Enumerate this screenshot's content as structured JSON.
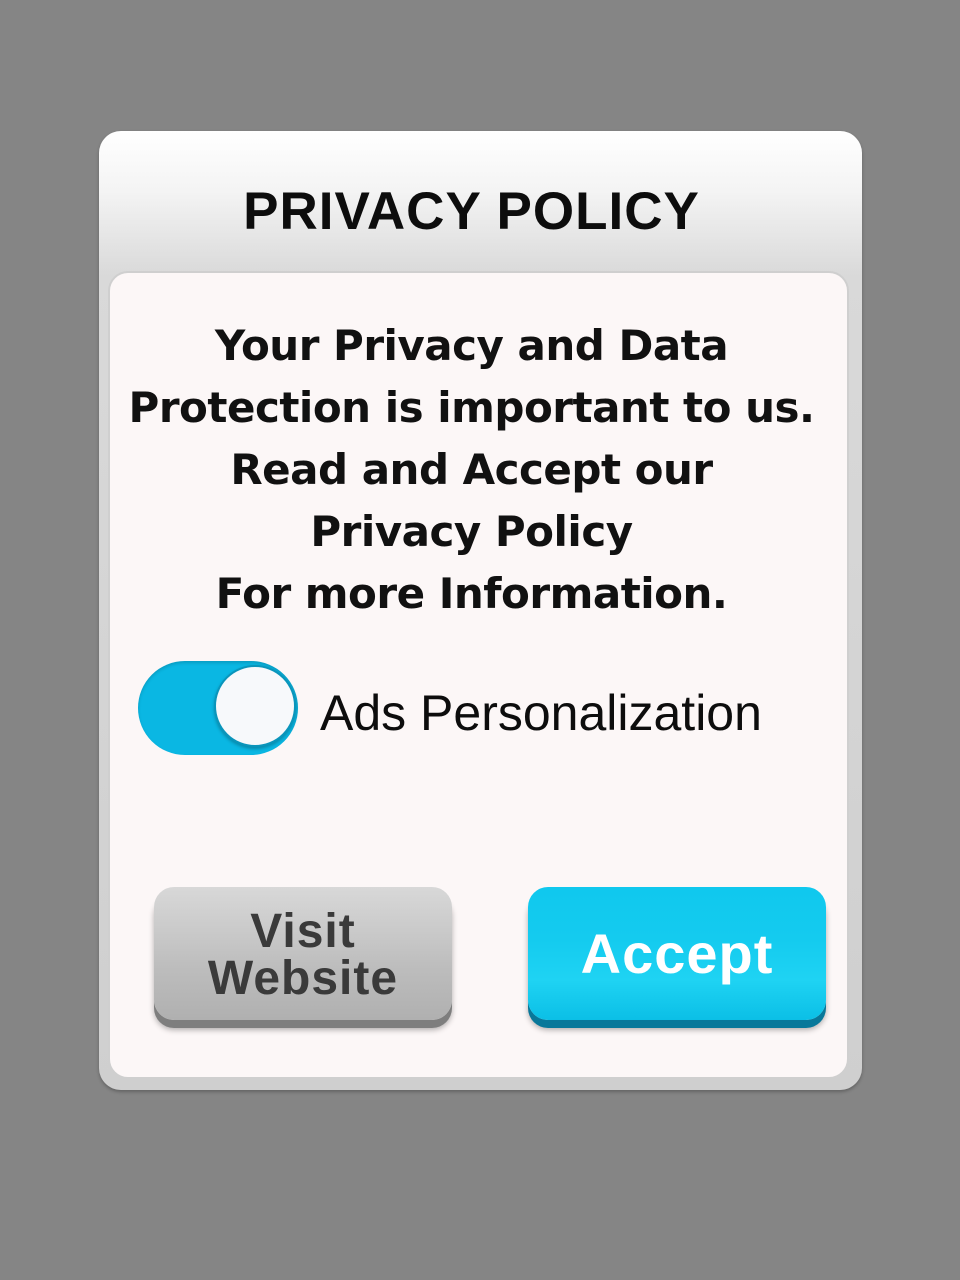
{
  "dialog": {
    "title": "PRIVACY POLICY",
    "message_lines": [
      "Your Privacy and Data",
      "Protection is important to us.",
      "Read and Accept our",
      "Privacy Policy",
      "For more Information."
    ],
    "toggle": {
      "label": "Ads Personalization",
      "state": "on",
      "color": "#0ab7e3"
    },
    "buttons": {
      "visit_website_lines": [
        "Visit",
        "Website"
      ],
      "accept_label": "Accept"
    }
  },
  "colors": {
    "background": "#858585",
    "panel": "#fcf7f7",
    "accept": "#12c9ef",
    "visit": "#c4c4c4"
  }
}
